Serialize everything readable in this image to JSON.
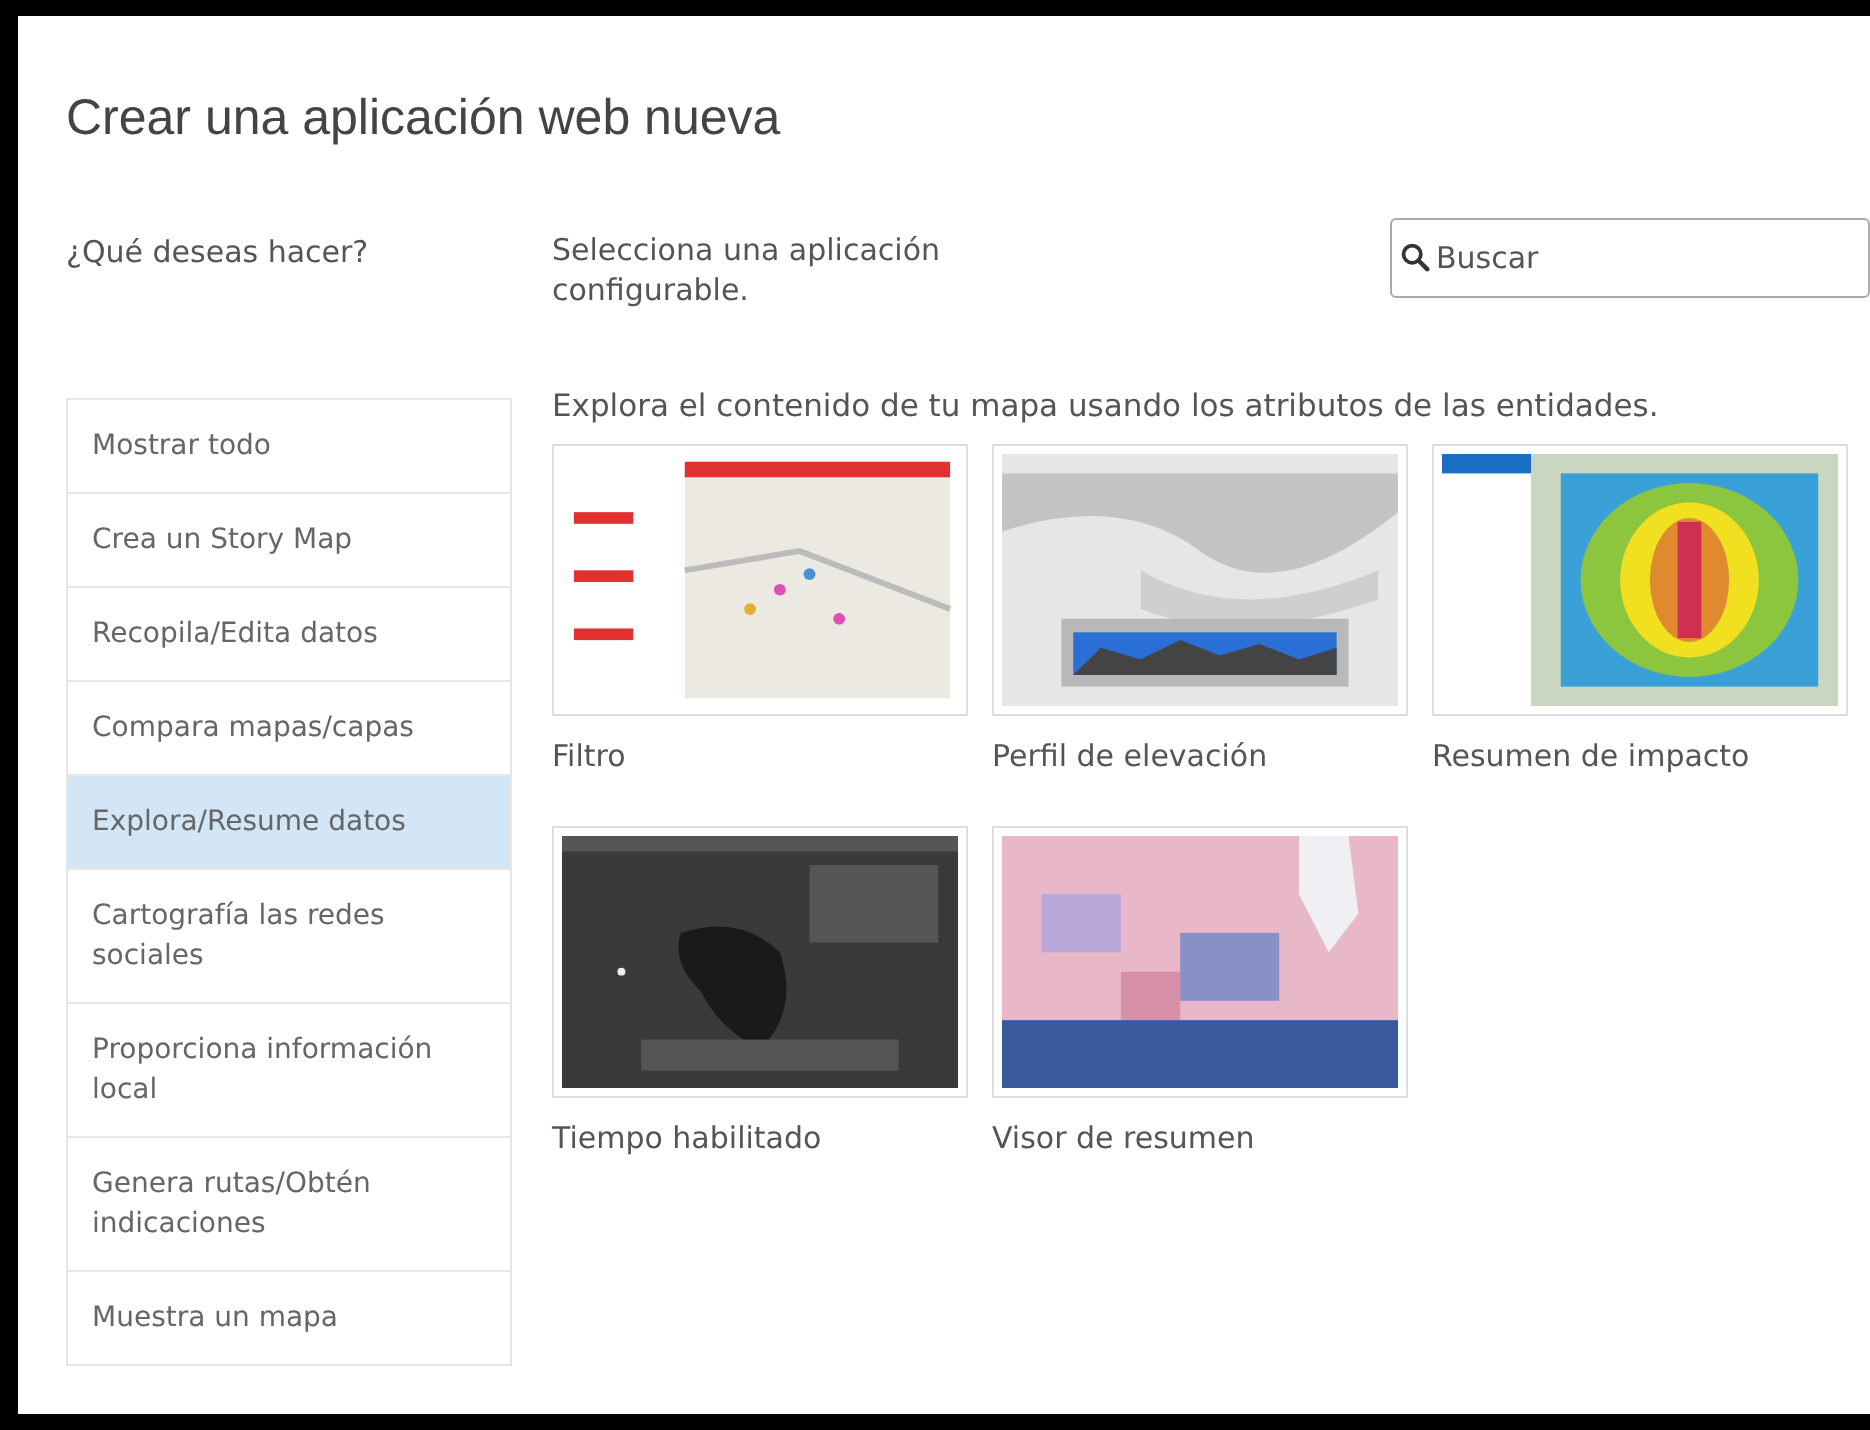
{
  "dialog": {
    "title": "Crear una aplicación web nueva"
  },
  "sidebar": {
    "heading": "¿Qué deseas hacer?",
    "items": [
      {
        "label": "Mostrar todo",
        "selected": false
      },
      {
        "label": "Crea un Story Map",
        "selected": false
      },
      {
        "label": "Recopila/Edita datos",
        "selected": false
      },
      {
        "label": "Compara mapas/capas",
        "selected": false
      },
      {
        "label": "Explora/Resume datos",
        "selected": true
      },
      {
        "label": "Cartografía las redes sociales",
        "selected": false
      },
      {
        "label": "Proporciona información local",
        "selected": false
      },
      {
        "label": "Genera rutas/Obtén indicaciones",
        "selected": false
      },
      {
        "label": "Muestra un mapa",
        "selected": false
      }
    ]
  },
  "content": {
    "instruction": "Selecciona una aplicación configurable.",
    "search": {
      "placeholder": "Buscar"
    },
    "description": "Explora el contenido de tu mapa usando los atributos de las entidades.",
    "apps": [
      {
        "title": "Filtro",
        "kind": "picture"
      },
      {
        "title": "Perfil de elevación",
        "kind": "picture"
      },
      {
        "title": "Resumen de impacto",
        "kind": "picture"
      },
      {
        "title": "Tiempo habilitado",
        "kind": "picture"
      },
      {
        "title": "Visor de resumen",
        "kind": "picture"
      }
    ]
  }
}
